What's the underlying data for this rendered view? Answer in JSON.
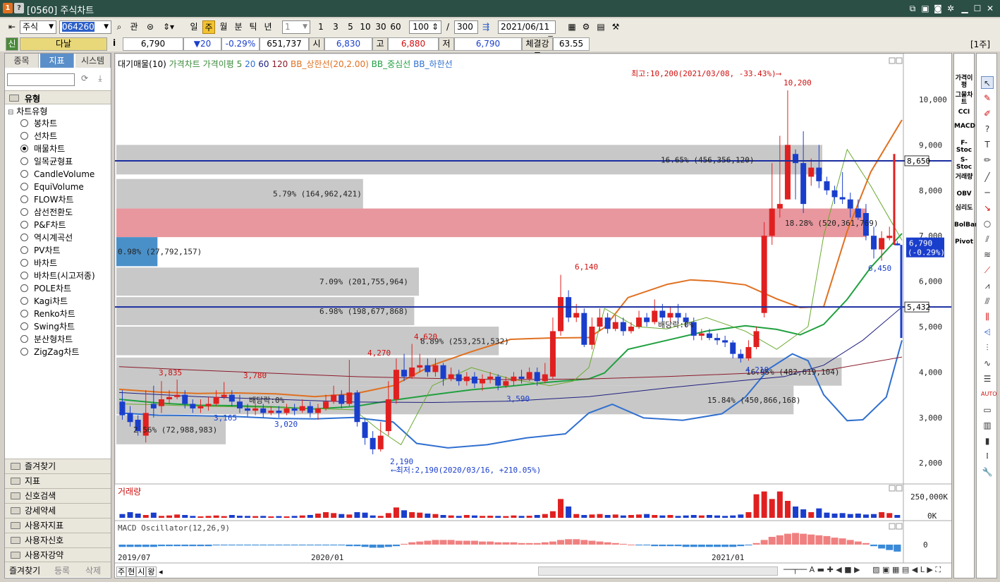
{
  "window": {
    "num_badge": "1",
    "help_badge": "?",
    "title": "[0560] 주식차트"
  },
  "toolbar": {
    "market": "주식",
    "code": "064260",
    "btn_gwan": "관",
    "periods": [
      "일",
      "주",
      "월",
      "분",
      "틱",
      "년"
    ],
    "active_period": "주",
    "unit_value": "1",
    "units": [
      "1",
      "3",
      "5",
      "10",
      "30",
      "60"
    ],
    "count": "100",
    "sep": "/",
    "total": "300",
    "date": "2021/06/11",
    "scale_label": "[1주]"
  },
  "quote": {
    "flag": "신",
    "name": "다날",
    "info": "i",
    "price": "6,790",
    "change": "▼20",
    "change_pct": "-0.29%",
    "volume": "651,737",
    "open_label": "시",
    "open": "6,830",
    "high_label": "고",
    "high": "6,880",
    "low_label": "저",
    "low": "6,790",
    "strength_label": "체결강도",
    "strength": "63.55"
  },
  "left_panel": {
    "tabs": [
      "종목",
      "지표",
      "시스템"
    ],
    "active_tab": "지표",
    "root": "유형",
    "subroot": "차트유형",
    "chart_types": [
      "봉차트",
      "선차트",
      "매물차트",
      "일목균형표",
      "CandleVolume",
      "EquiVolume",
      "FLOW차트",
      "삼선전환도",
      "P&F차트",
      "역시계곡선",
      "PV차트",
      "바차트",
      "바차트(시고저종)",
      "POLE차트",
      "Kagi차트",
      "Renko차트",
      "Swing차트",
      "분산형차트",
      "ZigZag차트"
    ],
    "selected": "매물차트",
    "sections": [
      "즐겨찾기",
      "지표",
      "신호검색",
      "강세약세",
      "사용자지표",
      "사용자신호",
      "사용자강약"
    ],
    "bottom_tabs": [
      "즐겨찾기",
      "등록",
      "삭제"
    ]
  },
  "chart": {
    "legend": [
      "대기매물(10)",
      "가격차트",
      "가격이평",
      "5",
      "20",
      "60",
      "120",
      "BB_상한선(20,2.00)",
      "BB_중심선",
      "BB_하한선"
    ],
    "legend_colors": [
      "#000000",
      "#000000",
      "#3a8a3a",
      "#3a8a3a",
      "#3070d0",
      "#202080",
      "#8b1a2a",
      "#e07020",
      "#20a040",
      "#3070d0"
    ],
    "high_note": "최고:10,200(2021/03/08, -33.43%)⟶",
    "low_note": "⟵최저:2,190(2020/03/16, +210.05%)",
    "volume_title": "거래량",
    "macd_title": "MACD Oscillator(12,26,9)",
    "y_labels": [
      "10,000",
      "9,000",
      "8,000",
      "7,000",
      "6,000",
      "5,000",
      "4,000",
      "3,000",
      "2,000"
    ],
    "vol_labels": [
      "250,000K",
      "0K"
    ],
    "macd_zero": "0",
    "x_labels": [
      "2019/07",
      "2020/01",
      "2021/01"
    ],
    "current_price": "6,790",
    "current_pct": "(-0.29%)",
    "line_a": "8,650",
    "line_b": "5,432",
    "nav_tabs": [
      "주",
      "현",
      "시",
      "왕"
    ],
    "price_labels": [
      "10,200",
      "6,450",
      "6,140",
      "4,620",
      "4,270",
      "3,835",
      "3,780",
      "3,590",
      "3,165",
      "3,020",
      "2,190",
      "4,210"
    ],
    "profile": [
      {
        "text": "16.65% (456,356,120)"
      },
      {
        "text": "5.79% (164,962,421)"
      },
      {
        "text": "18.28% (520,361,769)"
      },
      {
        "text": "0.98% (27,792,157)"
      },
      {
        "text": "7.09% (201,755,964)"
      },
      {
        "text": "6.98% (198,677,868)"
      },
      {
        "text": "8.89% (253,251,532)"
      },
      {
        "text": "16.95% (482,619,104)"
      },
      {
        "text": "15.84% (450,866,168)"
      },
      {
        "text": "2.56% (72,988,983)"
      }
    ],
    "dividend_labels": [
      "배당락:0%",
      "배당락:0%"
    ]
  },
  "right_tools": {
    "labels": [
      "가격이평",
      "그물차트",
      "CCI",
      "MACD",
      "F-Stoc",
      "S-Stoc",
      "거래량",
      "OBV",
      "심리도",
      "BolBand",
      "Pivot"
    ]
  }
}
